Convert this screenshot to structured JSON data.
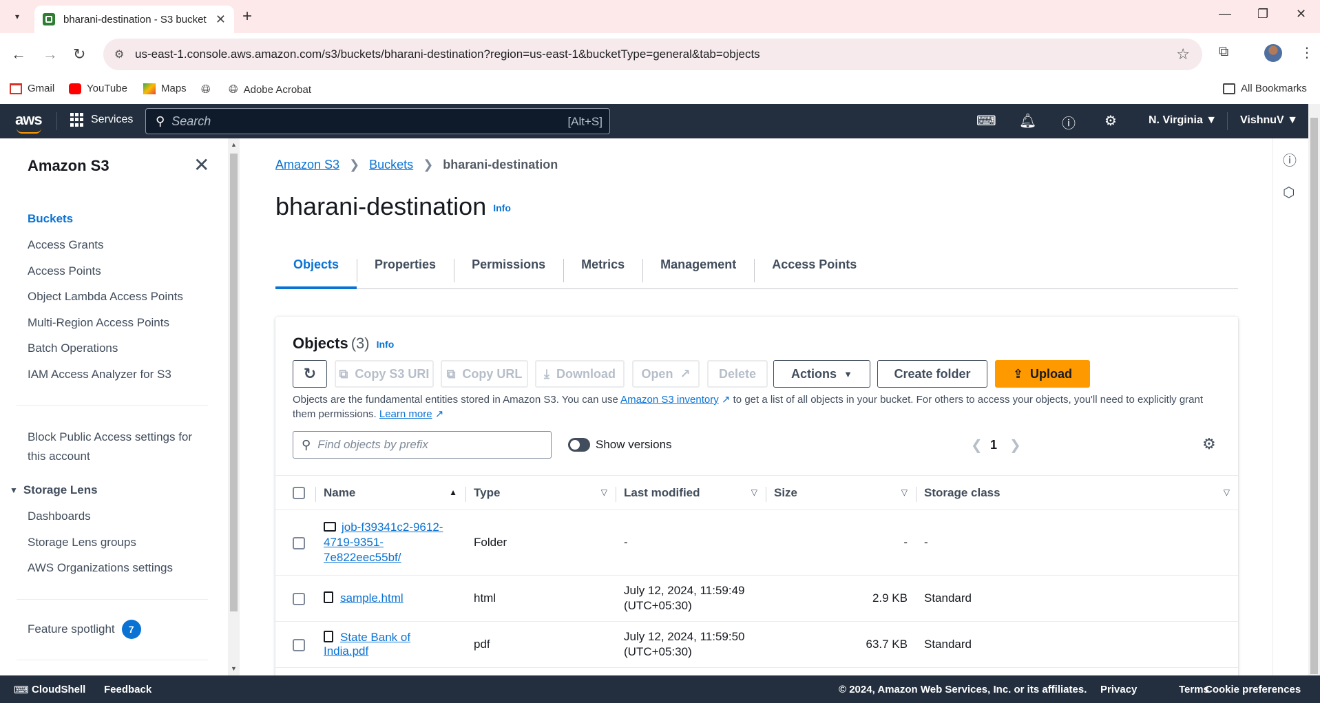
{
  "browser": {
    "tab_title": "bharani-destination - S3 bucket",
    "url": "us-east-1.console.aws.amazon.com/s3/buckets/bharani-destination?region=us-east-1&bucketType=general&tab=objects",
    "bookmarks": [
      "Gmail",
      "YouTube",
      "Maps",
      "Adobe Acrobat"
    ],
    "all_bookmarks": "All Bookmarks"
  },
  "aws_header": {
    "logo": "aws",
    "services": "Services",
    "search_placeholder": "Search",
    "search_shortcut": "[Alt+S]",
    "region": "N. Virginia ▼",
    "user": "VishnuV ▼"
  },
  "sidebar": {
    "title": "Amazon S3",
    "items": [
      "Buckets",
      "Access Grants",
      "Access Points",
      "Object Lambda Access Points",
      "Multi-Region Access Points",
      "Batch Operations",
      "IAM Access Analyzer for S3"
    ],
    "block_public_line1": "Block Public Access settings for",
    "block_public_line2": "this account",
    "storage_lens": "Storage Lens",
    "storage_lens_items": [
      "Dashboards",
      "Storage Lens groups",
      "AWS Organizations settings"
    ],
    "feature_spotlight": "Feature spotlight",
    "feature_count": "7"
  },
  "breadcrumb": [
    "Amazon S3",
    "Buckets",
    "bharani-destination"
  ],
  "page": {
    "title": "bharani-destination",
    "info": "Info",
    "tabs": [
      "Objects",
      "Properties",
      "Permissions",
      "Metrics",
      "Management",
      "Access Points"
    ]
  },
  "objects": {
    "title": "Objects",
    "count": "(3)",
    "info": "Info",
    "buttons": {
      "copy_uri": "Copy S3 URI",
      "copy_url": "Copy URL",
      "download": "Download",
      "open": "Open",
      "delete": "Delete",
      "actions": "Actions",
      "create_folder": "Create folder",
      "upload": "Upload"
    },
    "desc_part1": "Objects are the fundamental entities stored in Amazon S3. You can use ",
    "desc_link": "Amazon S3 inventory",
    "desc_part2": " to get a list of all objects in your bucket. For others to access your objects, you'll need to explicitly grant them permissions. ",
    "learn_more": "Learn more",
    "filter_placeholder": "Find objects by prefix",
    "show_versions": "Show versions",
    "page_number": "1",
    "columns": [
      "Name",
      "Type",
      "Last modified",
      "Size",
      "Storage class"
    ],
    "rows": [
      {
        "name_l1": "job-f39341c2-9612-",
        "name_l2": "4719-9351-",
        "name_l3": "7e822eec55bf/",
        "type": "Folder",
        "modified_l1": "-",
        "modified_l2": "",
        "size": "-",
        "class": "-"
      },
      {
        "name": "sample.html",
        "type": "html",
        "modified_l1": "July 12, 2024, 11:59:49",
        "modified_l2": "(UTC+05:30)",
        "size": "2.9 KB",
        "class": "Standard"
      },
      {
        "name": "State Bank of India.pdf",
        "type": "pdf",
        "modified_l1": "July 12, 2024, 11:59:50",
        "modified_l2": "(UTC+05:30)",
        "size": "63.7 KB",
        "class": "Standard"
      }
    ]
  },
  "footer": {
    "cloudshell": "CloudShell",
    "feedback": "Feedback",
    "copyright": "© 2024, Amazon Web Services, Inc. or its affiliates.",
    "privacy": "Privacy",
    "terms": "Terms",
    "cookies": "Cookie preferences"
  }
}
